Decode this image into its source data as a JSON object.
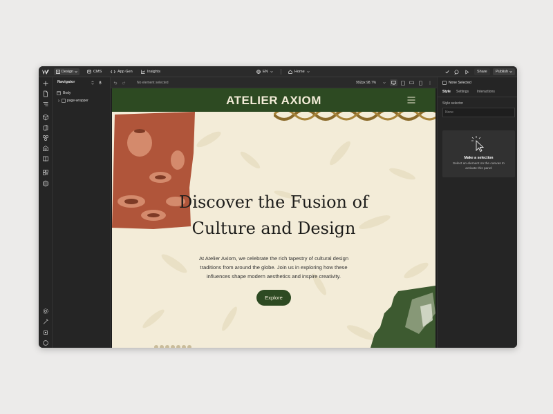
{
  "topbar": {
    "design_label": "Design",
    "cms_label": "CMS",
    "appgen_label": "App Gen",
    "insights_label": "Insights",
    "locale_label": "EN",
    "page_label": "Home",
    "share_label": "Share",
    "publish_label": "Publish"
  },
  "canvasbar": {
    "status": "No element selected",
    "viewport": "992px 98.7%"
  },
  "navigator": {
    "title": "Navigator",
    "tree": [
      {
        "label": "Body"
      },
      {
        "label": "page-wrapper"
      }
    ]
  },
  "right_panel": {
    "selection_label": "None Selected",
    "tabs": [
      {
        "label": "Style"
      },
      {
        "label": "Settings"
      },
      {
        "label": "Interactions"
      }
    ],
    "style_selector_label": "Style selector",
    "style_selector_value": "None",
    "empty_title": "Make a selection",
    "empty_text_line1": "Select an element on the canvas to",
    "empty_text_line2": "activate this panel"
  },
  "site": {
    "brand": "ATELIER AXIOM",
    "headline_line1": "Discover the Fusion of",
    "headline_line2": "Culture and Design",
    "body_line1": "At Atelier Axiom, we celebrate the rich tapestry of cultural design",
    "body_line2": "traditions from around the globe. Join us in exploring how these",
    "body_line3": "influences shape modern aesthetics and inspire creativity.",
    "cta_label": "Explore"
  },
  "colors": {
    "brand_green": "#2d4a22",
    "cream": "#f3ecd8",
    "terracotta": "#b0553a",
    "editor_dark": "#1e1e1e"
  }
}
